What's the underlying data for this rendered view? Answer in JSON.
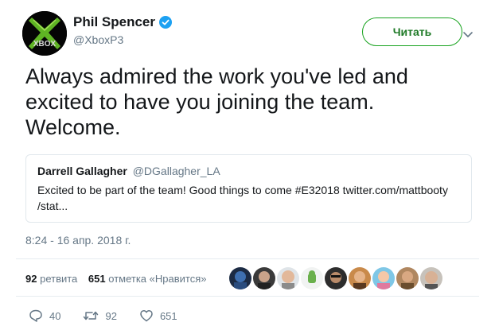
{
  "author": {
    "display_name": "Phil Spencer",
    "handle": "@XboxP3",
    "verified": true,
    "avatar_text": "XBOX"
  },
  "follow_button": {
    "label": "Читать"
  },
  "tweet": {
    "text": "Always admired the work you've led and excited to have you joining the team. Welcome.",
    "timestamp": "8:24 - 16 апр. 2018 г."
  },
  "quote": {
    "name": "Darrell Gallagher",
    "handle": "@DGallagher_LA",
    "text": "Excited to be part of the team! Good things to come #E32018 twitter.com/mattbooty /stat..."
  },
  "stats": {
    "retweets_count": "92",
    "retweets_label": "ретвита",
    "likes_count": "651",
    "likes_label": "отметка «Нравится»"
  },
  "liked_by_avatars": [
    "avatar-1",
    "avatar-2",
    "avatar-3",
    "avatar-4",
    "avatar-5",
    "avatar-6",
    "avatar-7",
    "avatar-8",
    "avatar-9"
  ],
  "actions": {
    "reply_count": "40",
    "retweet_count": "92",
    "like_count": "651"
  },
  "colors": {
    "follow_green": "#18a31f",
    "secondary_text": "#657786",
    "verified_blue": "#1da1f2"
  }
}
